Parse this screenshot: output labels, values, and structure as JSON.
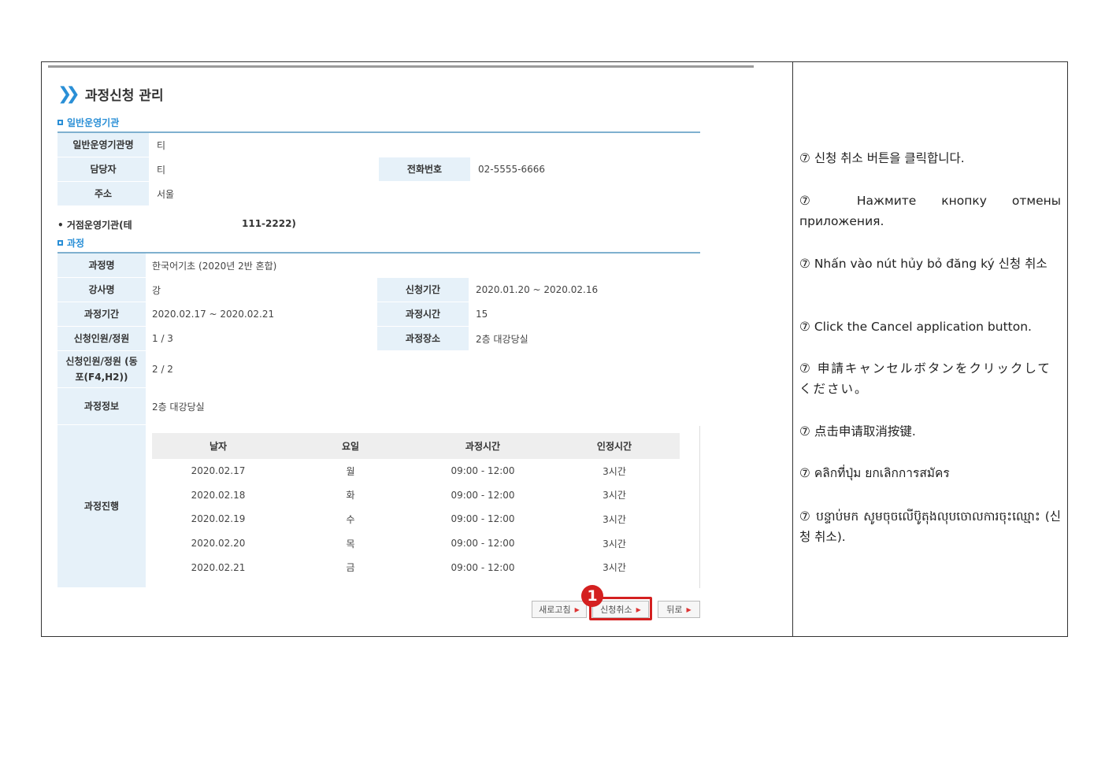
{
  "page": {
    "title": "과정신청 관리",
    "sections": {
      "org": "일반운영기관",
      "course": "과정"
    },
    "org": {
      "name_label": "일반운영기관명",
      "name_value": "티",
      "manager_label": "담당자",
      "manager_value": "티",
      "phone_label": "전화번호",
      "phone_value": "02-5555-6666",
      "address_label": "주소",
      "address_value": "서울"
    },
    "base_org": {
      "label": "• 거점운영기관(테",
      "value": "111-2222)"
    },
    "course": {
      "name_label": "과정명",
      "name_value": "한국어기초 (2020년 2반 혼합)",
      "instructor_label": "강사명",
      "instructor_value": "강",
      "apply_period_label": "신청기간",
      "apply_period_value": "2020.01.20 ~ 2020.02.16",
      "period_label": "과정기간",
      "period_value": "2020.02.17 ~ 2020.02.21",
      "hours_label": "과정시간",
      "hours_value": "15",
      "capacity_label": "신청인원/정원",
      "capacity_value": "1 / 3",
      "place_label": "과정장소",
      "place_value": "2층 대강당실",
      "capacity2_label": "신청인원/정원 (동포(F4,H2))",
      "capacity2_value": "2 / 2",
      "info_label": "과정정보",
      "info_value": "2층 대강당실",
      "progress_label": "과정진행"
    },
    "schedule": {
      "headers": [
        "날자",
        "요일",
        "과정시간",
        "인정시간"
      ],
      "rows": [
        [
          "2020.02.17",
          "월",
          "09:00 - 12:00",
          "3시간"
        ],
        [
          "2020.02.18",
          "화",
          "09:00 - 12:00",
          "3시간"
        ],
        [
          "2020.02.19",
          "수",
          "09:00 - 12:00",
          "3시간"
        ],
        [
          "2020.02.20",
          "목",
          "09:00 - 12:00",
          "3시간"
        ],
        [
          "2020.02.21",
          "금",
          "09:00 - 12:00",
          "3시간"
        ]
      ]
    },
    "buttons": {
      "refresh": "새로고침",
      "cancel": "신청취소",
      "back": "뒤로"
    },
    "badge": "1"
  },
  "instructions": [
    "⑦ 신청 취소 버튼을 클릭합니다.",
    "⑦ Нажмите кнопку отмены приложения.",
    "⑦ Nhấn vào nút hủy bỏ đăng ký 신청 취소",
    "⑦ Click the Cancel application button.",
    "⑦ 申請キャンセルボタンをクリックしてください。",
    "⑦ 点击申请取消按键.",
    "⑦ คลิกที่ปุ่ม ยกเลิกการสมัคร",
    "⑦ បន្ទាប់មក សូមចុចលើប៊ូតុងលុបចោលការចុះឈ្មោះ (신청 취소)."
  ],
  "colors": {
    "accent": "#2a8fd6",
    "label_bg": "#e6f1f9",
    "highlight": "#d42020"
  }
}
